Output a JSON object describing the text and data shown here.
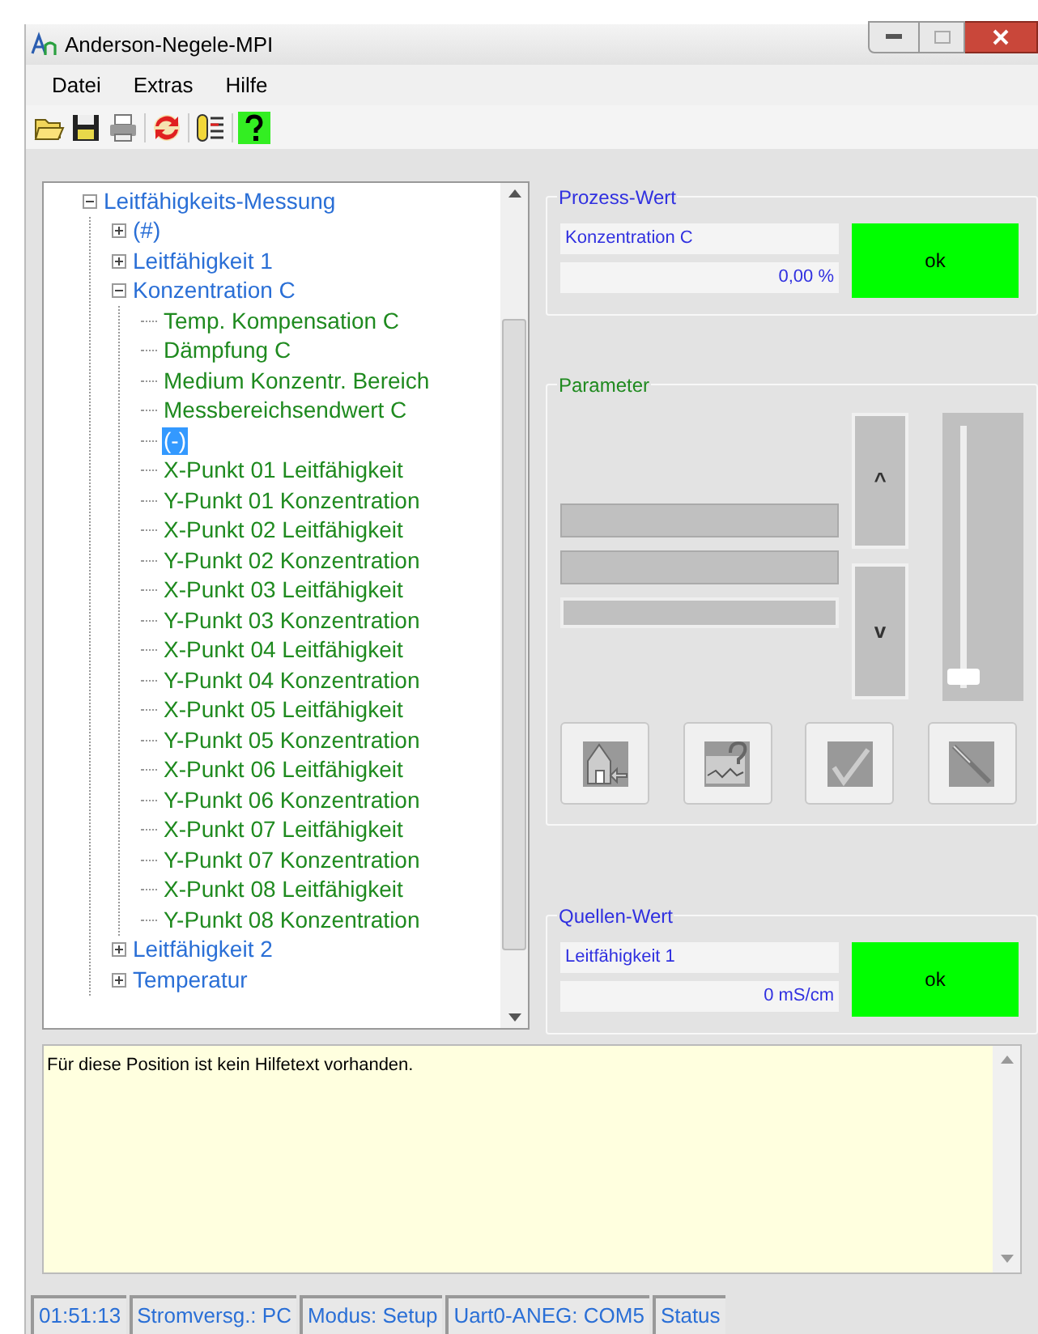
{
  "window": {
    "title": "Anderson-Negele-MPI"
  },
  "menu": [
    "Datei",
    "Extras",
    "Hilfe"
  ],
  "tree": [
    {
      "label": "Leitfähigkeits-Messung",
      "kind": "group",
      "expanded": true,
      "selected": false,
      "children": [
        {
          "label": "(#)",
          "kind": "group",
          "expanded": false,
          "selected": false
        },
        {
          "label": "Leitfähigkeit 1",
          "kind": "group",
          "expanded": false,
          "selected": false
        },
        {
          "label": "Konzentration C",
          "kind": "group",
          "expanded": true,
          "selected": false,
          "children": [
            {
              "label": "Temp. Kompensation C",
              "kind": "param",
              "selected": false
            },
            {
              "label": "Dämpfung C",
              "kind": "param",
              "selected": false
            },
            {
              "label": "Medium Konzentr. Bereich",
              "kind": "param",
              "selected": false
            },
            {
              "label": "Messbereichsendwert  C",
              "kind": "param",
              "selected": false
            },
            {
              "label": "(-)",
              "kind": "param",
              "selected": true
            },
            {
              "label": "X-Punkt 01 Leitfähigkeit",
              "kind": "param",
              "selected": false
            },
            {
              "label": "Y-Punkt 01 Konzentration",
              "kind": "param",
              "selected": false
            },
            {
              "label": "X-Punkt 02 Leitfähigkeit",
              "kind": "param",
              "selected": false
            },
            {
              "label": "Y-Punkt 02 Konzentration",
              "kind": "param",
              "selected": false
            },
            {
              "label": "X-Punkt 03 Leitfähigkeit",
              "kind": "param",
              "selected": false
            },
            {
              "label": "Y-Punkt 03 Konzentration",
              "kind": "param",
              "selected": false
            },
            {
              "label": "X-Punkt 04 Leitfähigkeit",
              "kind": "param",
              "selected": false
            },
            {
              "label": "Y-Punkt 04 Konzentration",
              "kind": "param",
              "selected": false
            },
            {
              "label": "X-Punkt 05 Leitfähigkeit",
              "kind": "param",
              "selected": false
            },
            {
              "label": "Y-Punkt 05 Konzentration",
              "kind": "param",
              "selected": false
            },
            {
              "label": "X-Punkt 06 Leitfähigkeit",
              "kind": "param",
              "selected": false
            },
            {
              "label": "Y-Punkt 06 Konzentration",
              "kind": "param",
              "selected": false
            },
            {
              "label": "X-Punkt 07 Leitfähigkeit",
              "kind": "param",
              "selected": false
            },
            {
              "label": "Y-Punkt 07 Konzentration",
              "kind": "param",
              "selected": false
            },
            {
              "label": "X-Punkt 08 Leitfähigkeit",
              "kind": "param",
              "selected": false
            },
            {
              "label": "Y-Punkt 08 Konzentration",
              "kind": "param",
              "selected": false
            }
          ]
        },
        {
          "label": "Leitfähigkeit 2",
          "kind": "group",
          "expanded": false,
          "selected": false
        },
        {
          "label": "Temperatur",
          "kind": "group",
          "expanded": false,
          "selected": false
        }
      ]
    }
  ],
  "process_value": {
    "title": "Prozess-Wert",
    "name": "Konzentration C",
    "value": "0,00 %",
    "status": "ok"
  },
  "parameter": {
    "title": "Parameter",
    "up": "^",
    "down": "v",
    "slider": {
      "level": 0
    }
  },
  "source_value": {
    "title": "Quellen-Wert",
    "name": "Leitfähigkeit 1",
    "value": "0 mS/cm",
    "status": "ok"
  },
  "help_text": "Für diese Position ist kein Hilfetext vorhanden.",
  "status_bar": [
    "01:51:13",
    "Stromversg.: PC",
    "Modus: Setup",
    "Uart0-ANEG: COM5",
    "Status"
  ]
}
